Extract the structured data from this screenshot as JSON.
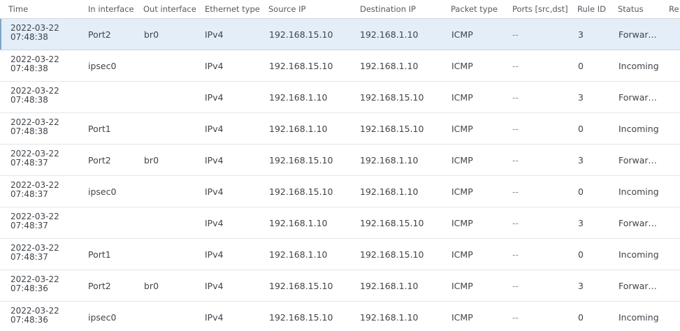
{
  "columns": {
    "time": "Time",
    "in_interface": "In interface",
    "out_interface": "Out interface",
    "ethernet_type": "Ethernet type",
    "source_ip": "Source IP",
    "destination_ip": "Destination IP",
    "packet_type": "Packet type",
    "ports": "Ports [src,dst]",
    "rule_id": "Rule ID",
    "status": "Status",
    "reason_truncated": "Re"
  },
  "rows": [
    {
      "date": "2022-03-22",
      "clock": "07:48:38",
      "in": "Port2",
      "out": "br0",
      "eth": "IPv4",
      "src": "192.168.15.10",
      "dst": "192.168.1.10",
      "ptype": "ICMP",
      "ports": "--",
      "rule": "3",
      "status": "Forward...",
      "selected": true
    },
    {
      "date": "2022-03-22",
      "clock": "07:48:38",
      "in": "ipsec0",
      "out": "",
      "eth": "IPv4",
      "src": "192.168.15.10",
      "dst": "192.168.1.10",
      "ptype": "ICMP",
      "ports": "--",
      "rule": "0",
      "status": "Incoming"
    },
    {
      "date": "2022-03-22",
      "clock": "07:48:38",
      "in": "",
      "out": "",
      "eth": "IPv4",
      "src": "192.168.1.10",
      "dst": "192.168.15.10",
      "ptype": "ICMP",
      "ports": "--",
      "rule": "3",
      "status": "Forward..."
    },
    {
      "date": "2022-03-22",
      "clock": "07:48:38",
      "in": "Port1",
      "out": "",
      "eth": "IPv4",
      "src": "192.168.1.10",
      "dst": "192.168.15.10",
      "ptype": "ICMP",
      "ports": "--",
      "rule": "0",
      "status": "Incoming"
    },
    {
      "date": "2022-03-22",
      "clock": "07:48:37",
      "in": "Port2",
      "out": "br0",
      "eth": "IPv4",
      "src": "192.168.15.10",
      "dst": "192.168.1.10",
      "ptype": "ICMP",
      "ports": "--",
      "rule": "3",
      "status": "Forward..."
    },
    {
      "date": "2022-03-22",
      "clock": "07:48:37",
      "in": "ipsec0",
      "out": "",
      "eth": "IPv4",
      "src": "192.168.15.10",
      "dst": "192.168.1.10",
      "ptype": "ICMP",
      "ports": "--",
      "rule": "0",
      "status": "Incoming"
    },
    {
      "date": "2022-03-22",
      "clock": "07:48:37",
      "in": "",
      "out": "",
      "eth": "IPv4",
      "src": "192.168.1.10",
      "dst": "192.168.15.10",
      "ptype": "ICMP",
      "ports": "--",
      "rule": "3",
      "status": "Forward..."
    },
    {
      "date": "2022-03-22",
      "clock": "07:48:37",
      "in": "Port1",
      "out": "",
      "eth": "IPv4",
      "src": "192.168.1.10",
      "dst": "192.168.15.10",
      "ptype": "ICMP",
      "ports": "--",
      "rule": "0",
      "status": "Incoming"
    },
    {
      "date": "2022-03-22",
      "clock": "07:48:36",
      "in": "Port2",
      "out": "br0",
      "eth": "IPv4",
      "src": "192.168.15.10",
      "dst": "192.168.1.10",
      "ptype": "ICMP",
      "ports": "--",
      "rule": "3",
      "status": "Forward..."
    },
    {
      "date": "2022-03-22",
      "clock": "07:48:36",
      "in": "ipsec0",
      "out": "",
      "eth": "IPv4",
      "src": "192.168.15.10",
      "dst": "192.168.1.10",
      "ptype": "ICMP",
      "ports": "--",
      "rule": "0",
      "status": "Incoming"
    }
  ],
  "colors": {
    "selected_row": "#e3eef8",
    "row_border": "#e2e5e9",
    "header_text": "#545a62",
    "cell_text": "#3f444a"
  }
}
